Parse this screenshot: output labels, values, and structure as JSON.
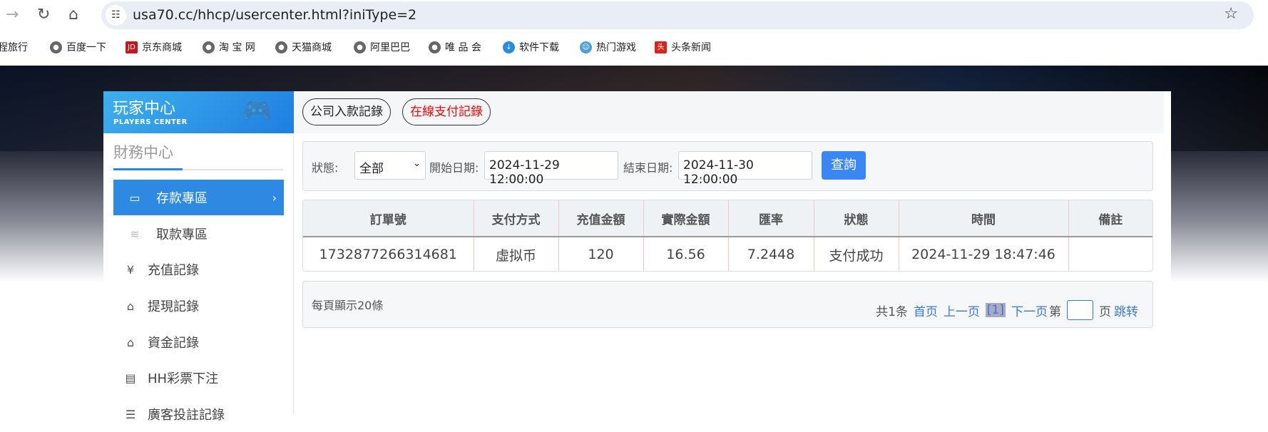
{
  "browser": {
    "url": "usa70.cc/hhcp/usercenter.html?iniType=2",
    "bookmarks": [
      {
        "label": "程旅行",
        "icon": "globe"
      },
      {
        "label": "百度一下",
        "icon": "globe"
      },
      {
        "label": "京东商城",
        "icon": "jd"
      },
      {
        "label": "淘 宝 网",
        "icon": "globe"
      },
      {
        "label": "天猫商城",
        "icon": "globe"
      },
      {
        "label": "阿里巴巴",
        "icon": "globe"
      },
      {
        "label": "唯 品 会",
        "icon": "globe"
      },
      {
        "label": "软件下载",
        "icon": "download"
      },
      {
        "label": "热门游戏",
        "icon": "game"
      },
      {
        "label": "头条新闻",
        "icon": "toutiao"
      }
    ]
  },
  "sidebar": {
    "title": "玩家中心",
    "subtitle": "PLAYERS CENTER",
    "section": "財務中心",
    "items": [
      {
        "label": "存款專區",
        "icon": "card",
        "active": true
      },
      {
        "label": "取款專區",
        "icon": "cash"
      },
      {
        "label": "充值記錄",
        "icon": "moneybag"
      },
      {
        "label": "提現記錄",
        "icon": "wallet"
      },
      {
        "label": "資金記錄",
        "icon": "safe"
      },
      {
        "label": "HH彩票下注",
        "icon": "list"
      },
      {
        "label": "廣客投註記錄",
        "icon": "list"
      }
    ]
  },
  "tabs": [
    {
      "label": "公司入款記錄",
      "color": "#222222"
    },
    {
      "label": "在線支付記錄",
      "color": "#ff0000"
    }
  ],
  "filter": {
    "status_label": "狀態:",
    "status_value": "全部",
    "start_label": "開始日期:",
    "start_value": "2024-11-29 12:00:00",
    "end_label": "結束日期:",
    "end_value": "2024-11-30 12:00:00",
    "query": "查詢"
  },
  "table": {
    "headers": [
      "訂單號",
      "支付方式",
      "充值金額",
      "實際金額",
      "匯率",
      "狀態",
      "時間",
      "備註"
    ],
    "rows": [
      [
        "1732877266314681",
        "虛拟币",
        "120",
        "16.56",
        "7.2448",
        "支付成功",
        "2024-11-29 18:47:46",
        ""
      ]
    ]
  },
  "pager": {
    "per_page": "每頁顯示20條",
    "total": "共1条",
    "first": "首页",
    "prev": "上一页",
    "current": "[1]",
    "next": "下一页",
    "page_prefix": "第",
    "page_suffix": "页",
    "jump": "跳转"
  },
  "colors": {
    "accent": "#2e89e3",
    "button": "#3a86f2",
    "link": "#3a76e0"
  }
}
